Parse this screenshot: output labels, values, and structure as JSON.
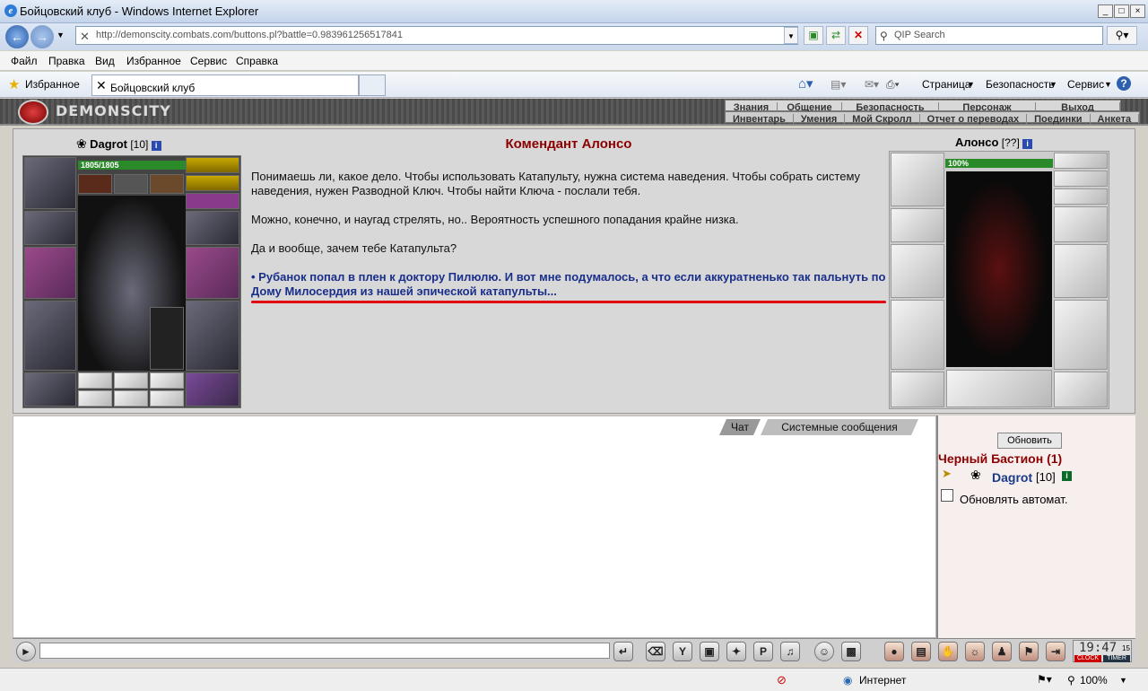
{
  "window": {
    "title": "Бойцовский клуб - Windows Internet Explorer",
    "min": "_",
    "max": "□",
    "close": "×"
  },
  "address": {
    "url": "http://demonscity.combats.com/buttons.pl?battle=0.983961256517841",
    "search_placeholder": "QIP Search"
  },
  "menu": [
    "Файл",
    "Правка",
    "Вид",
    "Избранное",
    "Сервис",
    "Справка"
  ],
  "favorites": {
    "label": "Избранное",
    "tab": "Бойцовский клуб"
  },
  "tools": {
    "page": "Страница",
    "safety": "Безопасность",
    "service": "Сервис"
  },
  "game": {
    "logo": "DEMONSCITY",
    "top_menu": [
      "Знания",
      "Общение",
      "Безопасность",
      "Персонаж",
      "Выход"
    ],
    "sub_menu": [
      "Инвентарь",
      "Умения",
      "Мой Скролл",
      "Отчет о переводах",
      "Поединки",
      "Анкета"
    ]
  },
  "player": {
    "name": "Dagrot",
    "level": "[10]",
    "hp": "1805/1805",
    "hp_fraction": 1.0
  },
  "npc": {
    "name": "Алонсо",
    "level": "[??]",
    "hp": "100%",
    "hp_fraction": 1.0
  },
  "dialog": {
    "title": "Комендант Алонсо",
    "p1": "Понимаешь ли, какое дело. Чтобы использовать Катапульту, нужна система наведения. Чтобы собрать систему наведения, нужен Разводной Ключ. Чтобы найти Ключа - послали тебя.",
    "p2": "Можно, конечно, и наугад стрелять, но.. Вероятность успешного попадания крайне низка.",
    "p3": "Да и вообще, зачем тебе Катапульта?",
    "link": "• Рубанок попал в плен к доктору Пилюлю. И вот мне подумалось, а что если аккуратненько так пальнуть по Дому Милосердия из нашей эпической катапульты..."
  },
  "tabs": {
    "chat": "Чат",
    "system": "Системные сообщения"
  },
  "right": {
    "refresh": "Обновить",
    "location": "Черный Бастион (1)",
    "member": "Dagrot",
    "member_level": "[10]",
    "auto": "Обновлять автомат."
  },
  "clock": {
    "time": "19:47",
    "sec": "15",
    "clock_label": "CLOCK",
    "timer_label": "TIMER"
  },
  "status": {
    "zone": "Интернет",
    "zoom": "100%"
  }
}
